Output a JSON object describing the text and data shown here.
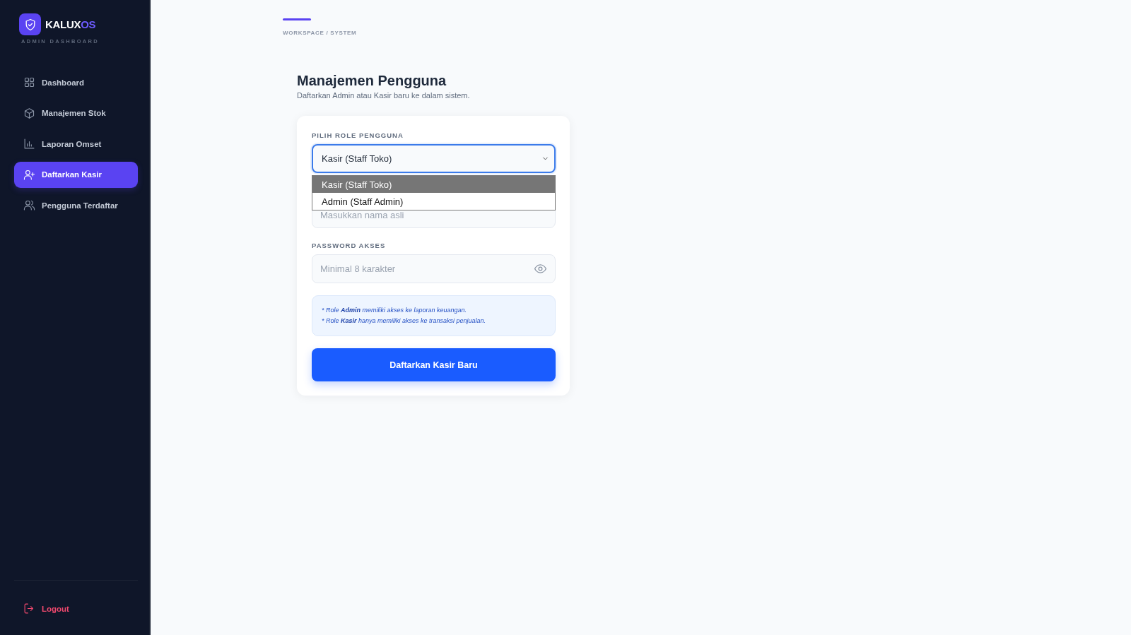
{
  "sidebar": {
    "brand": {
      "name": "KALUX",
      "accent": "OS",
      "subtitle": "ADMIN DASHBOARD"
    },
    "nav_items": [
      {
        "label": "Dashboard",
        "selected": false
      },
      {
        "label": "Manajemen Stok",
        "selected": false
      },
      {
        "label": "Laporan Omset",
        "selected": false
      },
      {
        "label": "Daftarkan Kasir",
        "selected": true
      },
      {
        "label": "Pengguna Terdaftar",
        "selected": false
      }
    ],
    "logout": {
      "label": "Logout"
    }
  },
  "breadcrumb": "WORKSPACE / SYSTEM",
  "page": {
    "title": "Manajemen Pengguna",
    "subtitle": "Daftarkan Admin atau Kasir baru ke dalam sistem."
  },
  "form": {
    "fields": [
      {
        "kind": "select",
        "label": "PILIH ROLE PENGGUNA",
        "value": "Kasir (Staff Toko)",
        "expanded": true,
        "options": [
          {
            "label": "Kasir (Staff Toko)",
            "selected": true
          },
          {
            "label": "Admin (Staff Admin)",
            "selected": false
          }
        ]
      },
      {
        "kind": "text",
        "placeholder": "Masukkan nama asli"
      },
      {
        "kind": "password",
        "label": "PASSWORD AKSES",
        "placeholder": "Minimal 8 karakter"
      }
    ],
    "notes": [
      "* Role **Admin** memiliki akses ke laporan keuangan.",
      "* Role **Kasir** hanya memiliki akses ke transaksi penjualan."
    ],
    "submit": "Daftarkan Kasir Baru"
  }
}
